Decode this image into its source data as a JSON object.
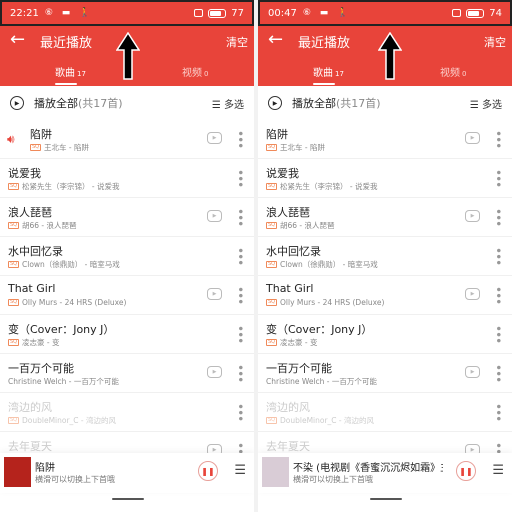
{
  "screens": [
    {
      "status": {
        "time": "22:21",
        "icons": "⑥ ▬ 🚶",
        "battery": "77",
        "battery_level": 0.77
      },
      "now_playing": {
        "title": "陷阱",
        "hint": "横滑可以切换上下首哦"
      },
      "playing_index": 0
    },
    {
      "status": {
        "time": "00:47",
        "icons": "⑥ ▬ 🚶",
        "battery": "74",
        "battery_level": 0.74
      },
      "now_playing": {
        "title": "不染 (电视剧《香蜜沉沉烬如霜》主题曲",
        "hint": "横滑可以切换上下首哦"
      },
      "playing_index": -1
    }
  ],
  "header": {
    "back_icon": "arrow-left",
    "title": "最近播放",
    "clear": "清空"
  },
  "tabs": [
    {
      "label": "歌曲",
      "count": "17"
    },
    {
      "label": "视频",
      "count": "0"
    }
  ],
  "play_all": {
    "label": "播放全部",
    "count": "(共17首)",
    "multi_select": "☰ 多选"
  },
  "badge": "SQ",
  "accent": "#e8443a",
  "songs": [
    {
      "name": "陷阱",
      "sub": "王北车 - 陷阱",
      "sq": true,
      "video": true
    },
    {
      "name": "说爱我",
      "sub": "松紧先生（李宗锦） - 说爱我",
      "sq": true,
      "video": false
    },
    {
      "name": "浪人琵琶",
      "sub": "胡66 - 浪人琵琶",
      "sq": true,
      "video": true
    },
    {
      "name": "水中回忆录",
      "sub": "Clown（徐鼎勋） - 暗室马戏",
      "sq": true,
      "video": false
    },
    {
      "name": "That Girl",
      "sub": "Olly Murs - 24 HRS (Deluxe)",
      "sq": true,
      "video": true
    },
    {
      "name": "变（Cover：Jony J）",
      "sub": "凌志豪 - 变",
      "sq": true,
      "video": false
    },
    {
      "name": "一百万个可能",
      "sub": "Christine Welch - 一百万个可能",
      "sq": false,
      "video": true
    },
    {
      "name": "湾边的风",
      "sub": "DoubleMinor_C - 湾边的风",
      "sq": true,
      "video": false,
      "disabled": true
    },
    {
      "name": "去年夏天",
      "sub": "",
      "sq": false,
      "video": true,
      "disabled": true
    }
  ]
}
